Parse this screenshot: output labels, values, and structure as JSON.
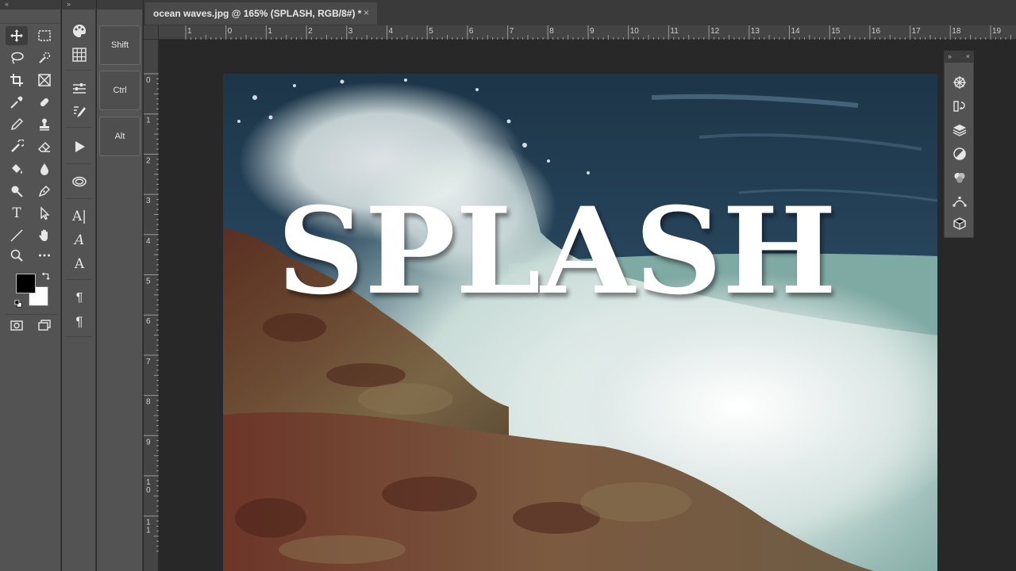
{
  "window": {
    "toolbar_collapse": "«",
    "panel_expand": "»"
  },
  "document": {
    "tab_title": "ocean waves.jpg @ 165% (SPLASH, RGB/8#) *",
    "close": "×"
  },
  "modifier_keys": [
    "Shift",
    "Ctrl",
    "Alt"
  ],
  "rulers": {
    "top": [
      "1",
      "0",
      "1",
      "2",
      "3",
      "4",
      "5",
      "6",
      "7",
      "8",
      "9",
      "10",
      "11",
      "12",
      "13",
      "14",
      "15",
      "16",
      "17",
      "18",
      "19"
    ],
    "left": [
      "0",
      "1",
      "2",
      "3",
      "4",
      "5",
      "6",
      "7",
      "8",
      "9",
      "1\n0",
      "1\n1"
    ]
  },
  "canvas": {
    "text_layer": "SPLASH"
  },
  "tools": [
    "move-tool",
    "rectangular-marquee-tool",
    "lasso-tool",
    "quick-selection-tool",
    "crop-tool",
    "frame-tool",
    "eyedropper-tool",
    "healing-brush-tool",
    "brush-tool",
    "clone-stamp-tool",
    "history-brush-tool",
    "eraser-tool",
    "paint-bucket-tool",
    "blur-tool",
    "dodge-tool",
    "pen-tool",
    "type-tool",
    "path-selection-tool",
    "line-tool",
    "hand-tool",
    "zoom-tool",
    "more-tools"
  ],
  "colors": {
    "foreground": "#000000",
    "background": "#ffffff",
    "panel": "#535353"
  },
  "right_panel": {
    "expand": "»",
    "close": "×"
  }
}
